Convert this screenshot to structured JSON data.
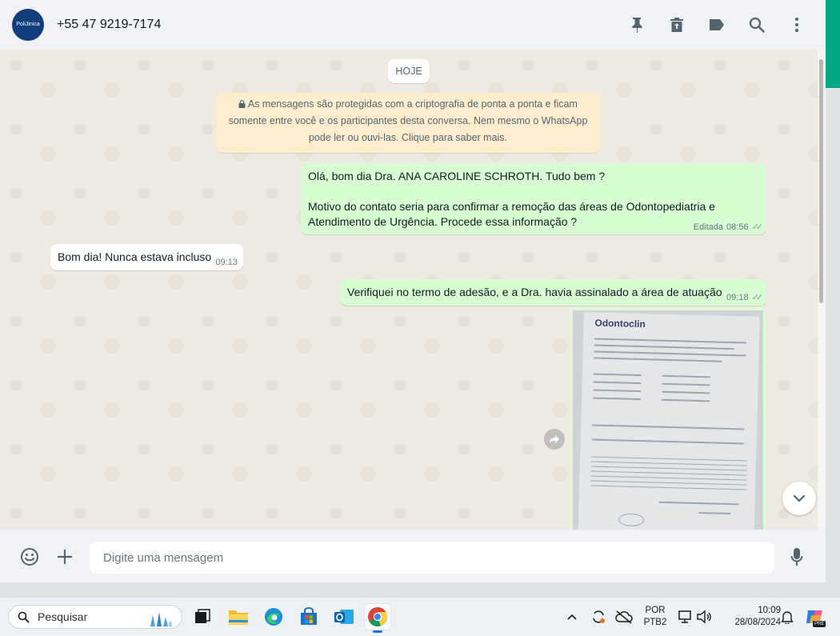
{
  "header": {
    "avatar_text": "PoliJinica",
    "contact_name": "+55 47 9219-7174",
    "icons": [
      "pin-icon",
      "archive-icon",
      "label-icon",
      "search-icon",
      "more-vertical-icon"
    ]
  },
  "chat": {
    "date_label": "HOJE",
    "encryption_notice": {
      "lines": [
        "As mensagens são protegidas com a criptografia de ponta a ponta e ficam",
        "somente entre você e os participantes desta conversa. Nem mesmo o WhatsApp",
        "pode ler ou ouvi-las. Clique para saber mais."
      ]
    },
    "messages": [
      {
        "direction": "outgoing",
        "lines": [
          "Olá, bom dia Dra. ANA CAROLINE SCHROTH. Tudo bem ?",
          "",
          "Motivo do contato seria para confirmar a remoção das áreas de Odontopediatria e",
          "Atendimento de Urgência. Procede essa informação ?"
        ],
        "edited_label": "Editada",
        "time": "08:56"
      },
      {
        "direction": "incoming",
        "text": "Bom dia! Nunca estava incluso",
        "time": "09:13"
      },
      {
        "direction": "outgoing",
        "text": "Verifiquei no termo de adesão, e a Dra. havia assinalado a área de atuação",
        "time": "09:18"
      },
      {
        "direction": "outgoing",
        "type": "image",
        "image_text": "Odontoclin"
      }
    ]
  },
  "footer": {
    "placeholder": "Digite uma mensagem",
    "icons": [
      "emoji-icon",
      "plus-icon",
      "microphone-icon"
    ]
  },
  "taskbar": {
    "search_placeholder": "Pesquisar",
    "apps": [
      "task-view-icon",
      "file-explorer-icon",
      "edge-icon",
      "store-icon",
      "outlook-icon",
      "chrome-icon"
    ],
    "lang_top": "POR",
    "lang_bottom": "PTB2",
    "time": "10:09",
    "date": "28/08/2024",
    "copilot_badge": "PRE"
  },
  "colors": {
    "outgoing_bubble": "#d9fdd3",
    "incoming_bubble": "#ffffff",
    "notice_bg": "#ffeecd",
    "accent": "#00a884"
  }
}
